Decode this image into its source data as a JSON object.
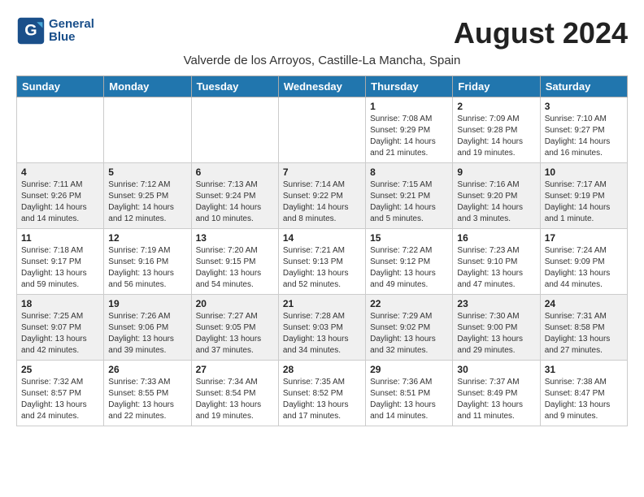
{
  "header": {
    "logo_line1": "General",
    "logo_line2": "Blue",
    "title": "August 2024",
    "subtitle": "Valverde de los Arroyos, Castille-La Mancha, Spain"
  },
  "days_of_week": [
    "Sunday",
    "Monday",
    "Tuesday",
    "Wednesday",
    "Thursday",
    "Friday",
    "Saturday"
  ],
  "weeks": [
    [
      {
        "day": "",
        "info": ""
      },
      {
        "day": "",
        "info": ""
      },
      {
        "day": "",
        "info": ""
      },
      {
        "day": "",
        "info": ""
      },
      {
        "day": "1",
        "info": "Sunrise: 7:08 AM\nSunset: 9:29 PM\nDaylight: 14 hours\nand 21 minutes."
      },
      {
        "day": "2",
        "info": "Sunrise: 7:09 AM\nSunset: 9:28 PM\nDaylight: 14 hours\nand 19 minutes."
      },
      {
        "day": "3",
        "info": "Sunrise: 7:10 AM\nSunset: 9:27 PM\nDaylight: 14 hours\nand 16 minutes."
      }
    ],
    [
      {
        "day": "4",
        "info": "Sunrise: 7:11 AM\nSunset: 9:26 PM\nDaylight: 14 hours\nand 14 minutes."
      },
      {
        "day": "5",
        "info": "Sunrise: 7:12 AM\nSunset: 9:25 PM\nDaylight: 14 hours\nand 12 minutes."
      },
      {
        "day": "6",
        "info": "Sunrise: 7:13 AM\nSunset: 9:24 PM\nDaylight: 14 hours\nand 10 minutes."
      },
      {
        "day": "7",
        "info": "Sunrise: 7:14 AM\nSunset: 9:22 PM\nDaylight: 14 hours\nand 8 minutes."
      },
      {
        "day": "8",
        "info": "Sunrise: 7:15 AM\nSunset: 9:21 PM\nDaylight: 14 hours\nand 5 minutes."
      },
      {
        "day": "9",
        "info": "Sunrise: 7:16 AM\nSunset: 9:20 PM\nDaylight: 14 hours\nand 3 minutes."
      },
      {
        "day": "10",
        "info": "Sunrise: 7:17 AM\nSunset: 9:19 PM\nDaylight: 14 hours\nand 1 minute."
      }
    ],
    [
      {
        "day": "11",
        "info": "Sunrise: 7:18 AM\nSunset: 9:17 PM\nDaylight: 13 hours\nand 59 minutes."
      },
      {
        "day": "12",
        "info": "Sunrise: 7:19 AM\nSunset: 9:16 PM\nDaylight: 13 hours\nand 56 minutes."
      },
      {
        "day": "13",
        "info": "Sunrise: 7:20 AM\nSunset: 9:15 PM\nDaylight: 13 hours\nand 54 minutes."
      },
      {
        "day": "14",
        "info": "Sunrise: 7:21 AM\nSunset: 9:13 PM\nDaylight: 13 hours\nand 52 minutes."
      },
      {
        "day": "15",
        "info": "Sunrise: 7:22 AM\nSunset: 9:12 PM\nDaylight: 13 hours\nand 49 minutes."
      },
      {
        "day": "16",
        "info": "Sunrise: 7:23 AM\nSunset: 9:10 PM\nDaylight: 13 hours\nand 47 minutes."
      },
      {
        "day": "17",
        "info": "Sunrise: 7:24 AM\nSunset: 9:09 PM\nDaylight: 13 hours\nand 44 minutes."
      }
    ],
    [
      {
        "day": "18",
        "info": "Sunrise: 7:25 AM\nSunset: 9:07 PM\nDaylight: 13 hours\nand 42 minutes."
      },
      {
        "day": "19",
        "info": "Sunrise: 7:26 AM\nSunset: 9:06 PM\nDaylight: 13 hours\nand 39 minutes."
      },
      {
        "day": "20",
        "info": "Sunrise: 7:27 AM\nSunset: 9:05 PM\nDaylight: 13 hours\nand 37 minutes."
      },
      {
        "day": "21",
        "info": "Sunrise: 7:28 AM\nSunset: 9:03 PM\nDaylight: 13 hours\nand 34 minutes."
      },
      {
        "day": "22",
        "info": "Sunrise: 7:29 AM\nSunset: 9:02 PM\nDaylight: 13 hours\nand 32 minutes."
      },
      {
        "day": "23",
        "info": "Sunrise: 7:30 AM\nSunset: 9:00 PM\nDaylight: 13 hours\nand 29 minutes."
      },
      {
        "day": "24",
        "info": "Sunrise: 7:31 AM\nSunset: 8:58 PM\nDaylight: 13 hours\nand 27 minutes."
      }
    ],
    [
      {
        "day": "25",
        "info": "Sunrise: 7:32 AM\nSunset: 8:57 PM\nDaylight: 13 hours\nand 24 minutes."
      },
      {
        "day": "26",
        "info": "Sunrise: 7:33 AM\nSunset: 8:55 PM\nDaylight: 13 hours\nand 22 minutes."
      },
      {
        "day": "27",
        "info": "Sunrise: 7:34 AM\nSunset: 8:54 PM\nDaylight: 13 hours\nand 19 minutes."
      },
      {
        "day": "28",
        "info": "Sunrise: 7:35 AM\nSunset: 8:52 PM\nDaylight: 13 hours\nand 17 minutes."
      },
      {
        "day": "29",
        "info": "Sunrise: 7:36 AM\nSunset: 8:51 PM\nDaylight: 13 hours\nand 14 minutes."
      },
      {
        "day": "30",
        "info": "Sunrise: 7:37 AM\nSunset: 8:49 PM\nDaylight: 13 hours\nand 11 minutes."
      },
      {
        "day": "31",
        "info": "Sunrise: 7:38 AM\nSunset: 8:47 PM\nDaylight: 13 hours\nand 9 minutes."
      }
    ]
  ]
}
